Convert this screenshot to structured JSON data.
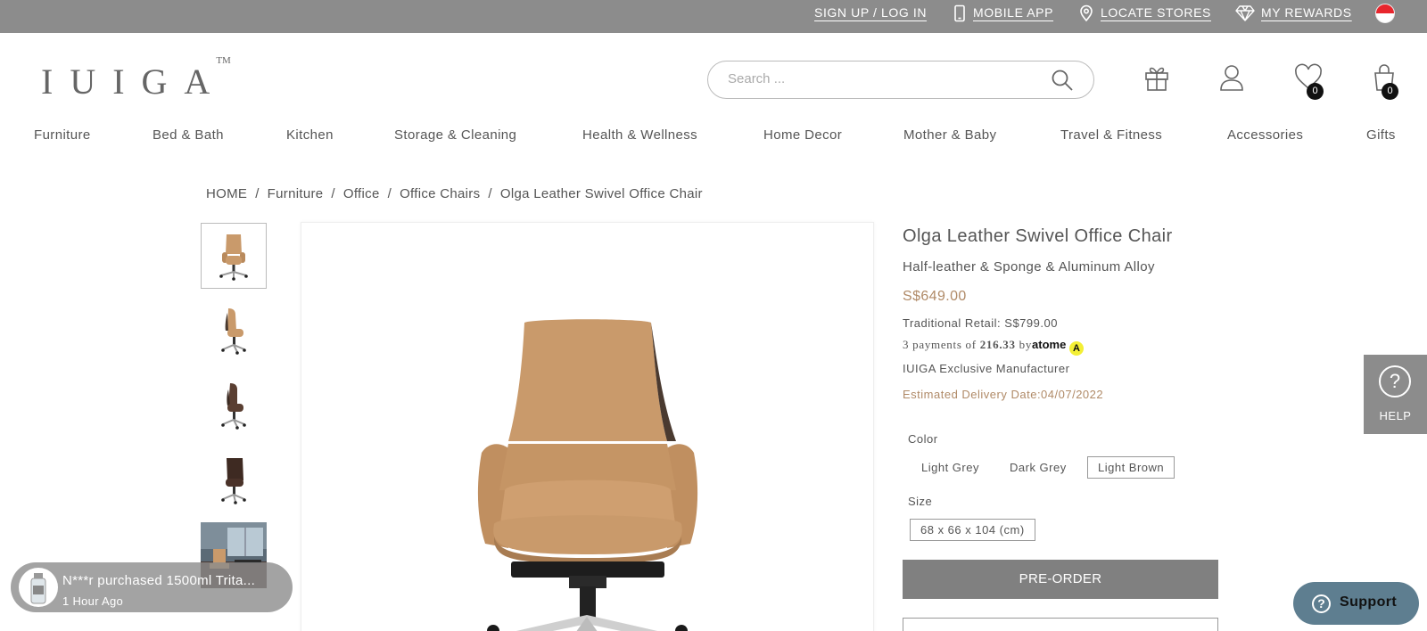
{
  "topbar": {
    "signup": "SIGN UP / LOG IN",
    "mobile_app": "MOBILE APP",
    "locate_stores": "LOCATE STORES",
    "my_rewards": "MY REWARDS",
    "flag": "singapore-flag-icon"
  },
  "header": {
    "logo": "IUIGA",
    "logo_tm": "TM",
    "search_placeholder": "Search ...",
    "wishlist_count": "0",
    "cart_count": "0"
  },
  "nav": [
    "Furniture",
    "Bed & Bath",
    "Kitchen",
    "Storage & Cleaning",
    "Health & Wellness",
    "Home Decor",
    "Mother & Baby",
    "Travel & Fitness",
    "Accessories",
    "Gifts"
  ],
  "breadcrumb": [
    "HOME",
    "Furniture",
    "Office",
    "Office Chairs",
    "Olga Leather Swivel Office Chair"
  ],
  "product": {
    "title": "Olga Leather Swivel Office Chair",
    "subtitle": "Half-leather & Sponge & Aluminum Alloy",
    "price": "S$649.00",
    "retail": "Traditional Retail: S$799.00",
    "installment_prefix": "3 payments of",
    "installment_amount": "216.33",
    "installment_by": "by",
    "installment_brand": "atome",
    "manufacturer": "IUIGA Exclusive Manufacturer",
    "delivery": "Estimated Delivery Date:04/07/2022",
    "color_label": "Color",
    "colors": [
      "Light Grey",
      "Dark Grey",
      "Light Brown"
    ],
    "selected_color": "Light Brown",
    "size_label": "Size",
    "sizes": [
      "68 x 66 x 104 (cm)"
    ],
    "preorder": "PRE-ORDER"
  },
  "help": {
    "label": "HELP"
  },
  "support": {
    "label": "Support"
  },
  "toast": {
    "message": "N***r purchased 1500ml Trita...",
    "time": "1 Hour Ago"
  },
  "colors": {
    "topbar_bg": "#8c8c8c",
    "price": "#b08a67",
    "button": "#808080",
    "support_bg": "#5e7e90",
    "chair_leather": "#c99a6b"
  }
}
